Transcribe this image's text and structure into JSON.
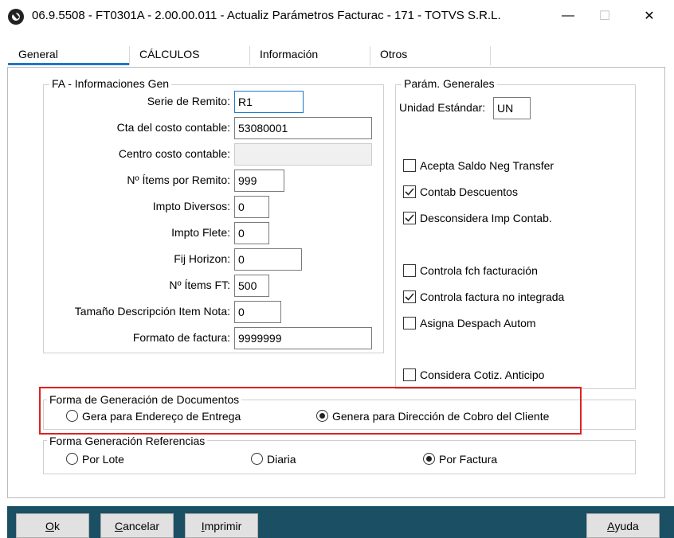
{
  "window": {
    "title": "06.9.5508 - FT0301A - 2.00.00.011 - Actualiz Parámetros Facturac - 171 - TOTVS S.R.L.",
    "icon": "totvs-logo-icon",
    "controls": {
      "minimize": "—",
      "maximize": "☐",
      "close": "✕"
    }
  },
  "tabs": [
    {
      "label": "General",
      "active": true
    },
    {
      "label": "CÁLCULOS",
      "active": false
    },
    {
      "label": "Información",
      "active": false
    },
    {
      "label": "Otros",
      "active": false
    }
  ],
  "fa_group": {
    "legend": "FA - Informaciones Gen",
    "fields": [
      {
        "label": "Serie de Remito:",
        "value": "R1",
        "state": "focused"
      },
      {
        "label": "Cta del costo contable:",
        "value": "53080001",
        "state": "normal"
      },
      {
        "label": "Centro costo contable:",
        "value": "",
        "state": "disabled"
      },
      {
        "label": "Nº Ítems por Remito:",
        "value": "999",
        "state": "normal"
      },
      {
        "label": "Impto Diversos:",
        "value": "0",
        "state": "normal"
      },
      {
        "label": "Impto Flete:",
        "value": "0",
        "state": "normal"
      },
      {
        "label": "Fij Horizon:",
        "value": "0",
        "state": "normal"
      },
      {
        "label": "Nº Ítems FT:",
        "value": "500",
        "state": "normal"
      },
      {
        "label": "Tamaño Descripción Item Nota:",
        "value": "0",
        "state": "normal"
      },
      {
        "label": "Formato de factura:",
        "value": "9999999",
        "state": "normal"
      }
    ]
  },
  "param_group": {
    "legend": "Parám. Generales",
    "unit_label": "Unidad Estándar:",
    "unit_value": "UN",
    "checkboxes": [
      {
        "label": "Acepta Saldo Neg Transfer",
        "checked": false
      },
      {
        "label": "Contab Descuentos",
        "checked": true
      },
      {
        "label": "Desconsidera Imp Contab.",
        "checked": true
      },
      {
        "label": "Controla fch facturación",
        "checked": false
      },
      {
        "label": "Controla factura no integrada",
        "checked": true
      },
      {
        "label": "Asigna Despach Autom",
        "checked": false
      },
      {
        "label": "Considera Cotiz. Anticipo",
        "checked": false
      }
    ]
  },
  "doc_group": {
    "legend": "Forma de Generación de Documentos",
    "options": [
      {
        "label": "Gera para Endereço de Entrega",
        "selected": false
      },
      {
        "label": "Genera para Dirección de Cobro del Cliente",
        "selected": true
      }
    ]
  },
  "ref_group": {
    "legend": "Forma Generación Referencias",
    "options": [
      {
        "label": "Por Lote",
        "selected": false
      },
      {
        "label": "Diaria",
        "selected": false
      },
      {
        "label": "Por Factura",
        "selected": true
      }
    ]
  },
  "buttons": {
    "ok": {
      "first": "O",
      "rest": "k"
    },
    "cancel": {
      "first": "C",
      "rest": "ancelar"
    },
    "print": {
      "first": "I",
      "rest": "mprimir"
    },
    "help": {
      "first": "A",
      "rest": "yuda"
    }
  },
  "colors": {
    "tab_underline": "#1e78c8",
    "bottom_bar": "#1b4f64",
    "highlight": "#e02020"
  }
}
